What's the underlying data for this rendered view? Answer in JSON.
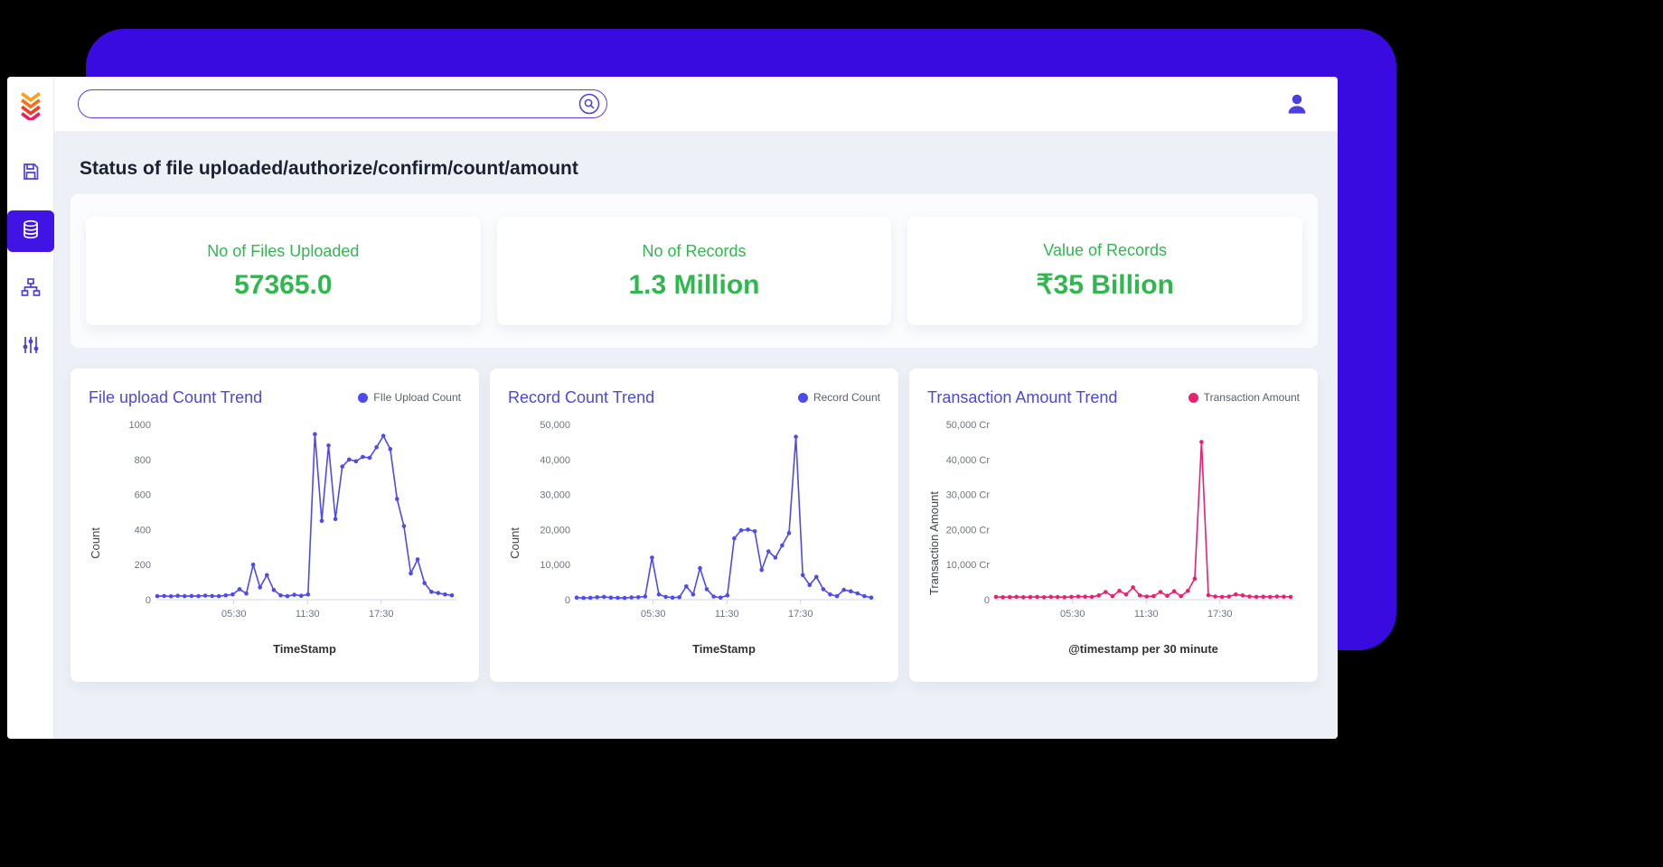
{
  "page": {
    "title": "Status of file uploaded/authorize/confirm/count/amount"
  },
  "header": {
    "search": {
      "value": "",
      "placeholder": ""
    }
  },
  "sidebar": {
    "items": [
      {
        "name": "logo"
      },
      {
        "name": "save"
      },
      {
        "name": "database",
        "selected": true
      },
      {
        "name": "sitemap"
      },
      {
        "name": "sliders"
      }
    ]
  },
  "colors": {
    "indigo_background": "#3a0be1",
    "accent_indigo": "#4a3fe0",
    "selected_tile": "#4014e4",
    "green": "#2eb84d",
    "chart_blue": "#4d4af0",
    "chart_pink": "#ed1e6f",
    "content_background": "#edf0f7"
  },
  "stats": [
    {
      "label": "No of Files Uploaded",
      "value": "57365.0"
    },
    {
      "label": "No of Records",
      "value": "1.3 Million"
    },
    {
      "label": "Value of Records",
      "value": "₹35 Billion"
    }
  ],
  "chart_data": [
    {
      "type": "line",
      "title": "File upload Count Trend",
      "legend": "FIle Upload Count",
      "color": "#4d4af0",
      "ylabel": "Count",
      "xlabel": "TimeStamp",
      "ylim": [
        0,
        1000
      ],
      "yticks": [
        "0",
        "200",
        "400",
        "600",
        "800",
        "1000"
      ],
      "xticks": [
        {
          "frac": 0.26,
          "label": "05:30"
        },
        {
          "frac": 0.51,
          "label": "11:30"
        },
        {
          "frac": 0.76,
          "label": "17:30"
        }
      ],
      "values": [
        20,
        21,
        19,
        22,
        20,
        21,
        20,
        23,
        21,
        20,
        24,
        30,
        60,
        35,
        200,
        70,
        140,
        55,
        25,
        20,
        28,
        22,
        30,
        945,
        450,
        880,
        460,
        760,
        800,
        790,
        815,
        810,
        870,
        935,
        860,
        575,
        420,
        150,
        230,
        95,
        45,
        38,
        30,
        25
      ]
    },
    {
      "type": "line",
      "title": "Record Count Trend",
      "legend": "Record Count",
      "color": "#4d4af0",
      "ylabel": "Count",
      "xlabel": "TimeStamp",
      "ylim": [
        0,
        50000
      ],
      "yticks": [
        "0",
        "10,000",
        "20,000",
        "30,000",
        "40,000",
        "50,000"
      ],
      "xticks": [
        {
          "frac": 0.26,
          "label": "05:30"
        },
        {
          "frac": 0.51,
          "label": "11:30"
        },
        {
          "frac": 0.76,
          "label": "17:30"
        }
      ],
      "values": [
        600,
        500,
        550,
        700,
        800,
        600,
        550,
        500,
        650,
        700,
        900,
        12000,
        1500,
        800,
        600,
        700,
        3800,
        1500,
        9000,
        3000,
        900,
        600,
        1200,
        17500,
        19800,
        20000,
        19500,
        8500,
        13800,
        12000,
        15500,
        19000,
        46500,
        7000,
        4200,
        6500,
        3000,
        1500,
        1000,
        2800,
        2400,
        1800,
        1000,
        600
      ]
    },
    {
      "type": "line",
      "title": "Transaction Amount Trend",
      "legend": "Transaction Amount",
      "color": "#ed1e6f",
      "ylabel": "Transaction Amount",
      "xlabel": "@timestamp per 30 minute",
      "ylim": [
        0,
        50000
      ],
      "yticks": [
        "0",
        "10,000 Cr",
        "20,000 Cr",
        "30,000 Cr",
        "40,000 Cr",
        "50,000 Cr"
      ],
      "xticks": [
        {
          "frac": 0.26,
          "label": "05:30"
        },
        {
          "frac": 0.51,
          "label": "11:30"
        },
        {
          "frac": 0.76,
          "label": "17:30"
        }
      ],
      "values": [
        800,
        700,
        750,
        800,
        700,
        750,
        800,
        700,
        800,
        750,
        700,
        800,
        900,
        850,
        800,
        1200,
        2200,
        1000,
        2500,
        1500,
        3500,
        1200,
        900,
        1000,
        2200,
        1100,
        2400,
        1000,
        2500,
        6000,
        45000,
        1300,
        900,
        800,
        900,
        1500,
        1200,
        900,
        800,
        850,
        800,
        900,
        850,
        800
      ]
    }
  ]
}
